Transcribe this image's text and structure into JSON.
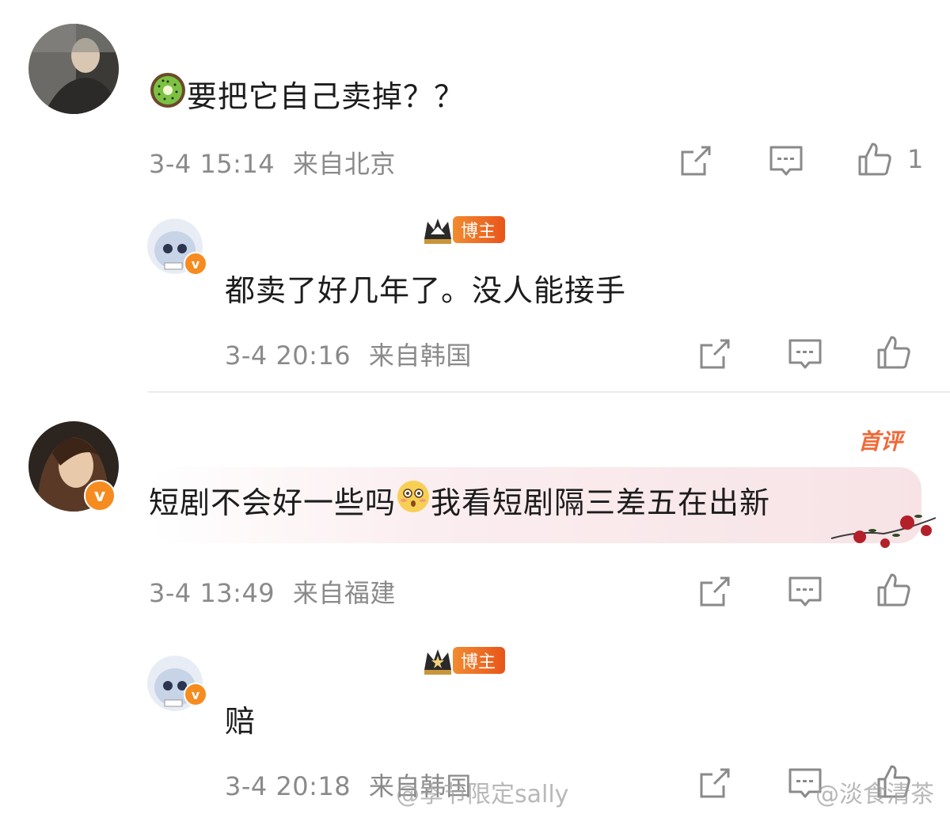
{
  "comments": [
    {
      "text_emoji": "kiwi-emoji",
      "text": "要把它自己卖掉？？",
      "time": "3-4 15:14",
      "location": "来自北京",
      "like_count": "1",
      "reply": {
        "badge": "博主",
        "text": "都卖了好几年了。没人能接手",
        "time": "3-4 20:16",
        "location": "来自韩国"
      }
    },
    {
      "first_tag": "首评",
      "text_before": "短剧不会好一些吗",
      "text_emoji": "flushed-emoji",
      "text_after": "我看短剧隔三差五在出新",
      "time": "3-4 13:49",
      "location": "来自福建",
      "reply": {
        "badge": "博主",
        "text": "赔",
        "time": "3-4 20:18",
        "location": "来自韩国"
      }
    }
  ],
  "watermarks": {
    "left": "@季节限定sally",
    "right": "@淡食清茶"
  },
  "colors": {
    "accent_orange": "#f06a3a",
    "meta_gray": "#8a8a8a",
    "blogger_badge": "#e8551a",
    "verified_badge": "#f68b1f"
  },
  "icons": {
    "share": "share-icon",
    "comment": "comment-icon",
    "like": "like-icon",
    "crown": "crown-icon",
    "verified": "verified-icon",
    "rose": "rose-decoration-icon"
  }
}
